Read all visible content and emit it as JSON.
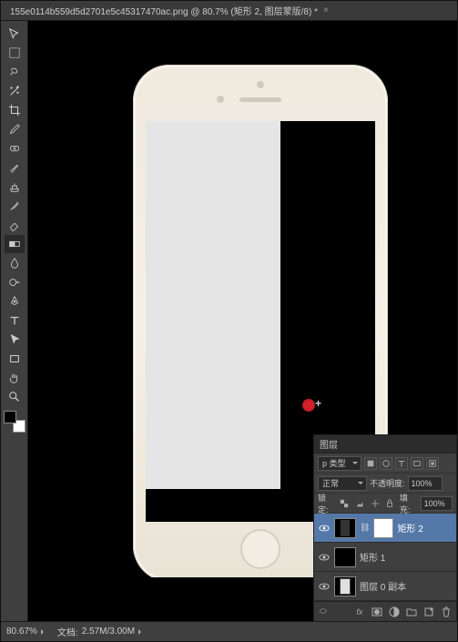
{
  "tab": {
    "title": "155e0114b559d5d2701e5c45317470ac.png @ 80.7% (矩形 2, 图层蒙版/8) *"
  },
  "layers_panel": {
    "title": "图层",
    "kind_label": "p 类型",
    "blend_mode": "正常",
    "opacity_label": "不透明度:",
    "opacity_value": "100%",
    "lock_label": "锁定:",
    "fill_label": "填充:",
    "fill_value": "100%",
    "layers": [
      {
        "name": "矩形 2"
      },
      {
        "name": "矩形 1"
      },
      {
        "name": "图层 0 副本"
      }
    ],
    "footer_fx": "fx"
  },
  "status": {
    "zoom": "80.67%",
    "doc_label": "文档:",
    "doc_value": "2.57M/3.00M"
  }
}
